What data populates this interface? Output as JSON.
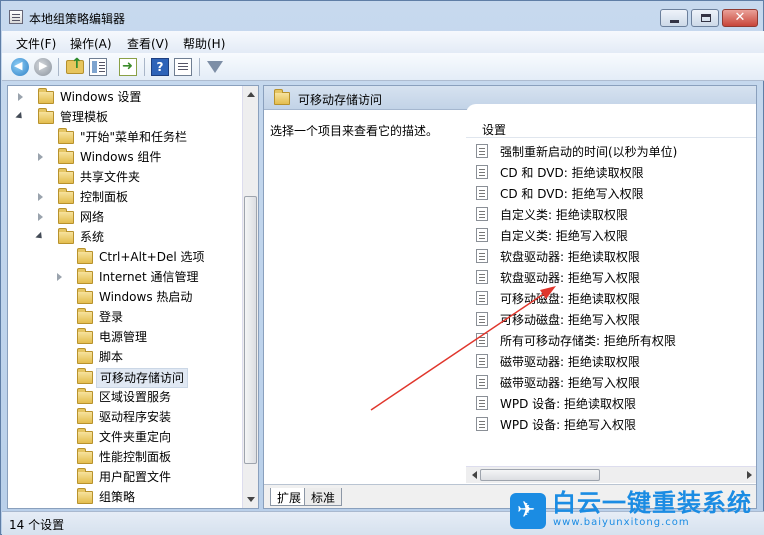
{
  "window": {
    "title": "本地组策略编辑器",
    "minimize_glyph": "",
    "maximize_glyph": "",
    "close_glyph": "✕"
  },
  "menu": [
    "文件(F)",
    "操作(A)",
    "查看(V)",
    "帮助(H)"
  ],
  "toolbar": {
    "icons": [
      "back-arrow-icon",
      "forward-arrow-icon",
      "folder-up-icon",
      "show-tree-icon",
      "export-list-icon",
      "help-icon",
      "properties-icon",
      "filter-icon"
    ],
    "help_glyph": "?"
  },
  "tree": [
    {
      "label": "Windows 设置",
      "twisty": "closed",
      "depth": 1
    },
    {
      "label": "管理模板",
      "twisty": "open",
      "depth": 1
    },
    {
      "label": "\"开始\"菜单和任务栏",
      "twisty": "",
      "depth": 2
    },
    {
      "label": "Windows 组件",
      "twisty": "closed",
      "depth": 2
    },
    {
      "label": "共享文件夹",
      "twisty": "",
      "depth": 2
    },
    {
      "label": "控制面板",
      "twisty": "closed",
      "depth": 2
    },
    {
      "label": "网络",
      "twisty": "closed",
      "depth": 2
    },
    {
      "label": "系统",
      "twisty": "open",
      "depth": 2
    },
    {
      "label": "Ctrl+Alt+Del 选项",
      "twisty": "",
      "depth": 3
    },
    {
      "label": "Internet 通信管理",
      "twisty": "closed",
      "depth": 3
    },
    {
      "label": "Windows 热启动",
      "twisty": "",
      "depth": 3
    },
    {
      "label": "登录",
      "twisty": "",
      "depth": 3
    },
    {
      "label": "电源管理",
      "twisty": "",
      "depth": 3
    },
    {
      "label": "脚本",
      "twisty": "",
      "depth": 3
    },
    {
      "label": "可移动存储访问",
      "twisty": "",
      "depth": 3,
      "selected": true
    },
    {
      "label": "区域设置服务",
      "twisty": "",
      "depth": 3
    },
    {
      "label": "驱动程序安装",
      "twisty": "",
      "depth": 3
    },
    {
      "label": "文件夹重定向",
      "twisty": "",
      "depth": 3
    },
    {
      "label": "性能控制面板",
      "twisty": "",
      "depth": 3
    },
    {
      "label": "用户配置文件",
      "twisty": "",
      "depth": 3
    },
    {
      "label": "组策略",
      "twisty": "",
      "depth": 3
    }
  ],
  "right": {
    "title": "可移动存储访问",
    "description": "选择一个项目来查看它的描述。",
    "column_header": "设置",
    "settings": [
      "强制重新启动的时间(以秒为单位)",
      "CD 和 DVD: 拒绝读取权限",
      "CD 和 DVD: 拒绝写入权限",
      "自定义类: 拒绝读取权限",
      "自定义类: 拒绝写入权限",
      "软盘驱动器: 拒绝读取权限",
      "软盘驱动器: 拒绝写入权限",
      "可移动磁盘: 拒绝读取权限",
      "可移动磁盘: 拒绝写入权限",
      "所有可移动存储类: 拒绝所有权限",
      "磁带驱动器: 拒绝读取权限",
      "磁带驱动器: 拒绝写入权限",
      "WPD 设备: 拒绝读取权限",
      "WPD 设备: 拒绝写入权限"
    ],
    "tabs": [
      "扩展",
      "标准"
    ]
  },
  "status": "14 个设置",
  "annotation_arrow_color": "#e0362c",
  "watermark": {
    "title": "白云一键重装系统",
    "url": "www.baiyunxitong.com",
    "color": "#1b8ce3"
  }
}
